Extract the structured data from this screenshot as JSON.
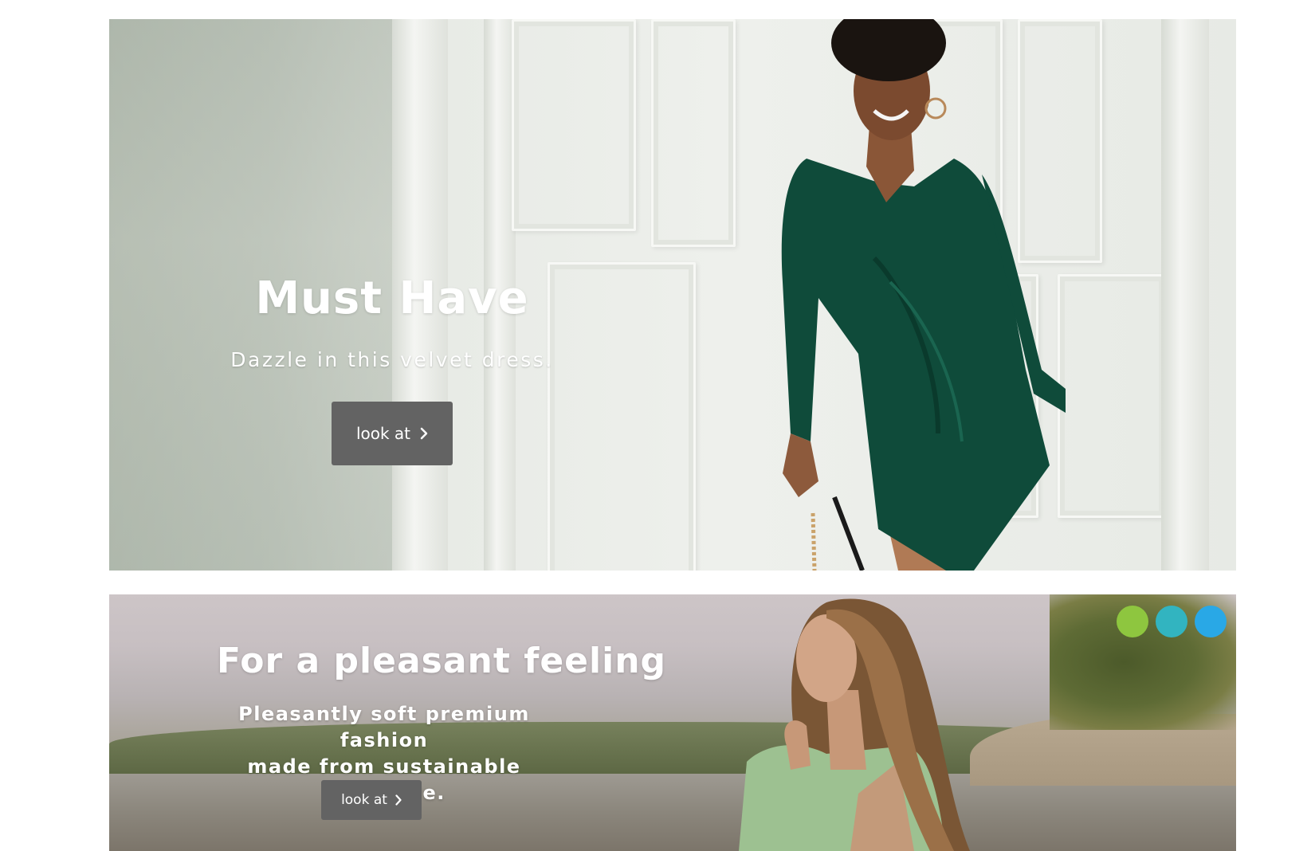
{
  "banners": [
    {
      "title": "Must Have",
      "subtitle": "Dazzle in this velvet dress.",
      "cta_label": "look at",
      "cta_icon": "chevron-right-icon"
    },
    {
      "title": "For a pleasant feeling",
      "subtitle_line1": "Pleasantly soft premium fashion",
      "subtitle_line2": "made from sustainable cashmere.",
      "cta_label": "look at",
      "cta_icon": "chevron-right-icon",
      "slider_dots": [
        {
          "color": "#8ec63f"
        },
        {
          "color": "#32b4c0"
        },
        {
          "color": "#29a8e6"
        }
      ]
    }
  ],
  "colors": {
    "cta_background": "#636363",
    "banner_text": "#ffffff"
  }
}
